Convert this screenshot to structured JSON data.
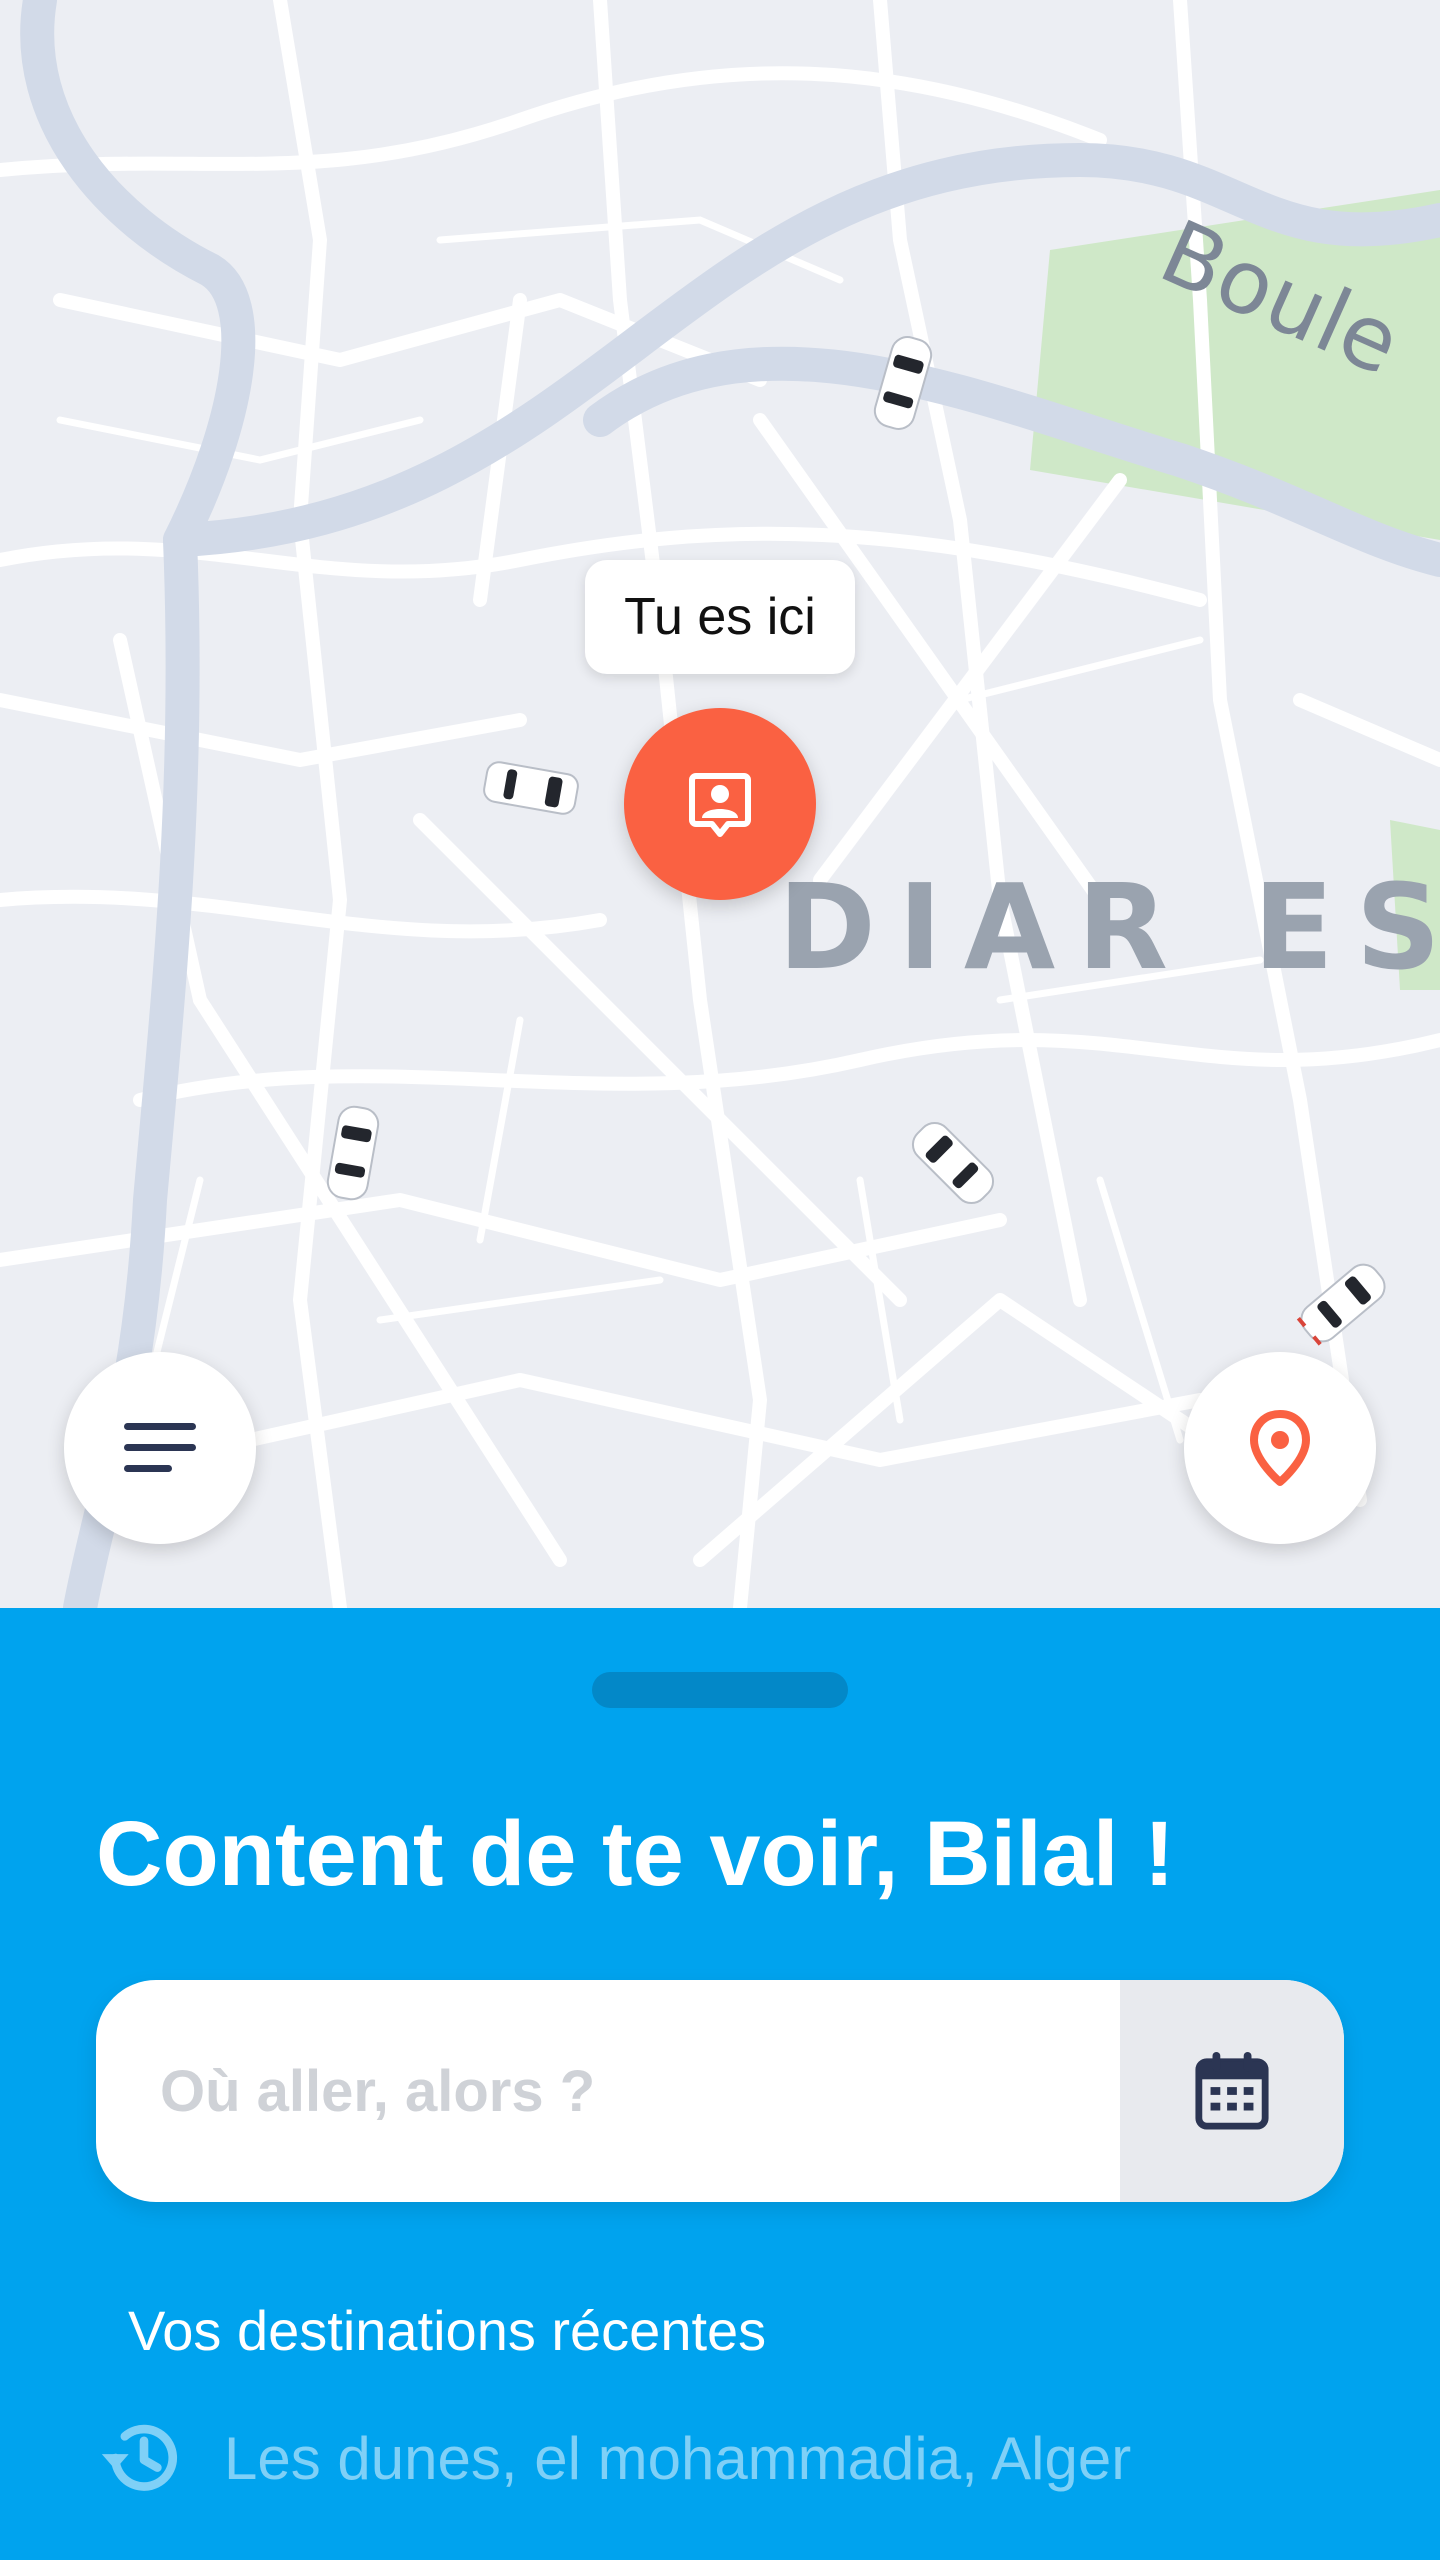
{
  "map": {
    "district_label": "DIAR ES S",
    "road_label": "Boule",
    "current_location_tooltip": "Tu es ici",
    "icons": {
      "current_location": "person-location-icon",
      "menu": "menu-icon",
      "locate": "map-pin-icon",
      "car": "car-icon"
    }
  },
  "sheet": {
    "greeting": "Content de te voir, Bilal !",
    "search": {
      "placeholder": "Où aller, alors ?",
      "value": ""
    },
    "schedule_icon": "calendar-icon",
    "recent_title": "Vos destinations récentes",
    "recent_items": [
      {
        "icon": "history-icon",
        "label": "Les dunes, el mohammadia, Alger"
      }
    ]
  },
  "colors": {
    "accent": "#fa6142",
    "sheet_background": "#00a3ee",
    "map_background": "#eceef3",
    "park_green": "#cfe8c8",
    "icon_dark": "#2b3553"
  }
}
